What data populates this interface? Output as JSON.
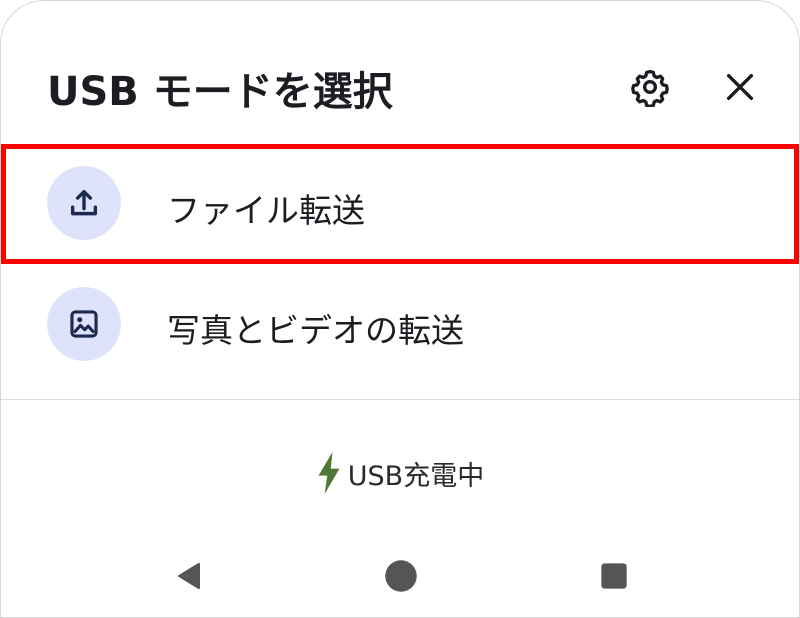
{
  "dialog": {
    "title": "USB モードを選択",
    "settings_icon": "gear-icon",
    "close_icon": "close-icon"
  },
  "options": [
    {
      "label": "ファイル転送",
      "icon": "upload-icon",
      "highlighted": true
    },
    {
      "label": "写真とビデオの転送",
      "icon": "image-icon",
      "highlighted": false
    }
  ],
  "status": {
    "charging_text": "USB充電中",
    "icon": "lightning-bolt-icon",
    "icon_color": "#4f7a35"
  },
  "navbar": {
    "back_icon": "back-triangle-icon",
    "home_icon": "home-circle-icon",
    "recents_icon": "recents-square-icon"
  },
  "colors": {
    "icon_bg": "#dee2fb",
    "icon_fg": "#1b2a4e",
    "highlight": "#ff0000",
    "nav": "#555555"
  }
}
